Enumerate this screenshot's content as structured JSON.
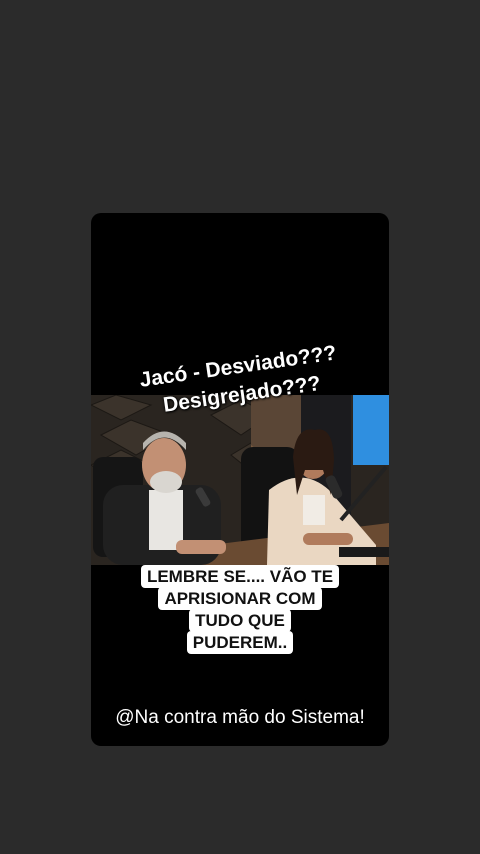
{
  "story": {
    "title_lines": [
      "Jacó - Desviado???",
      "Desigrejado???"
    ],
    "caption_lines": [
      "LEMBRE SE.... VÃO TE",
      "APRISIONAR COM",
      "TUDO QUE",
      "PUDEREM.."
    ],
    "watermark": "@Na contra mão do Sistema!"
  },
  "colors": {
    "background": "#2b2b2b",
    "card": "#000000",
    "caption_bg": "#ffffff"
  }
}
